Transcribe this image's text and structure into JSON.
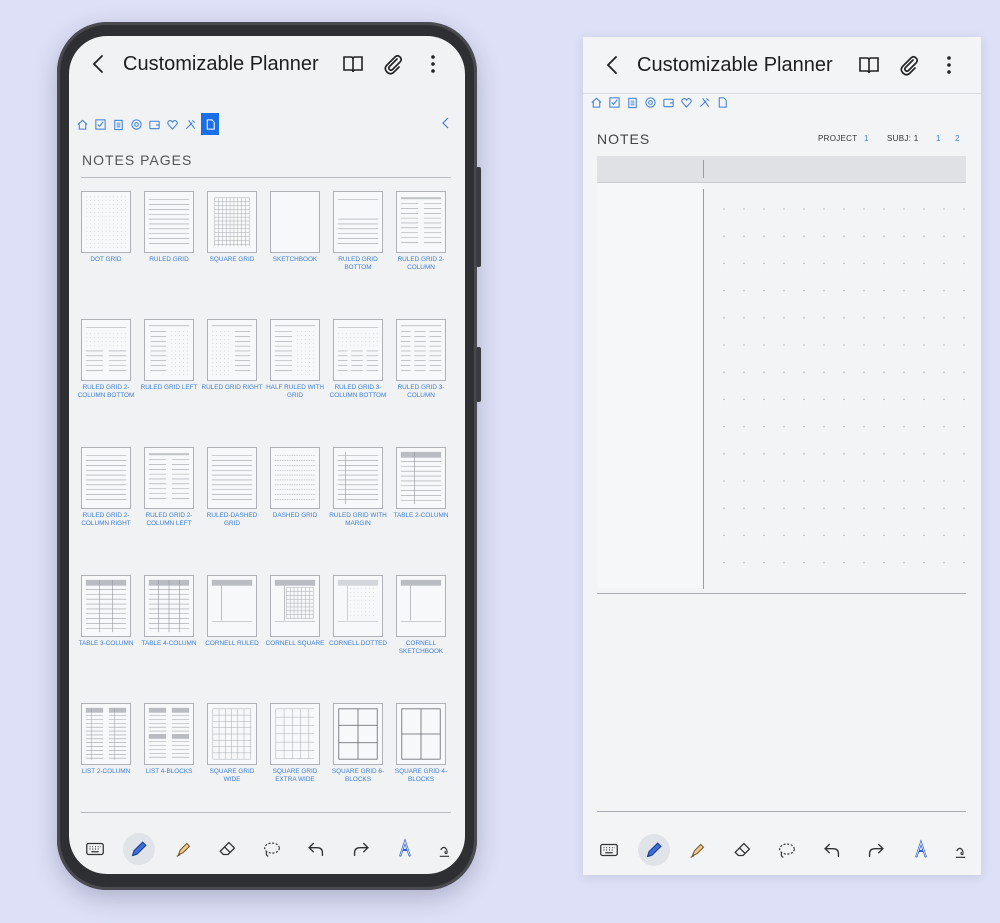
{
  "app": {
    "title": "Customizable Planner"
  },
  "tabs": [
    {
      "name": "home-tab-icon"
    },
    {
      "name": "checkbox-tab-icon"
    },
    {
      "name": "clipboard-tab-icon"
    },
    {
      "name": "target-tab-icon"
    },
    {
      "name": "wallet-tab-icon"
    },
    {
      "name": "heart-tab-icon"
    },
    {
      "name": "tools-tab-icon"
    },
    {
      "name": "notes-tab-icon"
    }
  ],
  "accent_color": "#3d7fd6",
  "active_tab_color": "#1a6fe8",
  "notes_index": {
    "heading": "NOTES PAGES",
    "templates": [
      {
        "label": "DOT GRID",
        "kind": "dot"
      },
      {
        "label": "RULED GRID",
        "kind": "ruled"
      },
      {
        "label": "SQUARE GRID",
        "kind": "square"
      },
      {
        "label": "SKETCHBOOK",
        "kind": "blank"
      },
      {
        "label": "RULED GRID BOTTOM",
        "kind": "ruled-bottom"
      },
      {
        "label": "RULED GRID 2-COLUMN",
        "kind": "ruled-2col"
      },
      {
        "label": "RULED GRID 2-COLUMN BOTTOM",
        "kind": "ruled-2col-bottom"
      },
      {
        "label": "RULED GRID LEFT",
        "kind": "ruled-left"
      },
      {
        "label": "RULED GRID RIGHT",
        "kind": "ruled-right"
      },
      {
        "label": "HALF RULED WITH GRID",
        "kind": "half-ruled"
      },
      {
        "label": "RULED GRID 3-COLUMN BOTTOM",
        "kind": "ruled-3col-bottom"
      },
      {
        "label": "RULED GRID 3-COLUMN",
        "kind": "ruled-3col"
      },
      {
        "label": "RULED GRID 2-COLUMN RIGHT",
        "kind": "ruled"
      },
      {
        "label": "RULED GRID 2-COLUMN LEFT",
        "kind": "ruled-2col"
      },
      {
        "label": "RULED-DASHED GRID",
        "kind": "ruled"
      },
      {
        "label": "DASHED GRID",
        "kind": "dashed"
      },
      {
        "label": "RULED GRID WITH MARGIN",
        "kind": "ruled-margin"
      },
      {
        "label": "TABLE 2-COLUMN",
        "kind": "table2"
      },
      {
        "label": "TABLE 3-COLUMN",
        "kind": "table3"
      },
      {
        "label": "TABLE 4-COLUMN",
        "kind": "table4"
      },
      {
        "label": "CORNELL RULED",
        "kind": "cornell-ruled"
      },
      {
        "label": "CORNELL SQUARE",
        "kind": "cornell-square"
      },
      {
        "label": "CORNELL DOTTED",
        "kind": "cornell-dotted"
      },
      {
        "label": "CORNELL SKETCHBOOK",
        "kind": "cornell-blank"
      },
      {
        "label": "LIST 2-COLUMN",
        "kind": "list2"
      },
      {
        "label": "LIST 4-BLOCKS",
        "kind": "list4"
      },
      {
        "label": "SQUARE GRID WIDE",
        "kind": "square-wide"
      },
      {
        "label": "SQUARE GRID EXTRA WIDE",
        "kind": "square-xwide"
      },
      {
        "label": "SQUARE GRID 6-BLOCKS",
        "kind": "blocks6"
      },
      {
        "label": "SQUARE GRID 4-BLOCKS",
        "kind": "blocks4"
      }
    ]
  },
  "notes_page": {
    "heading": "NOTES",
    "project_label": "PROJECT",
    "project_value": "1",
    "subj_label": "SUBJ: 1",
    "page_1": "1",
    "page_2": "2"
  },
  "toolbar": [
    {
      "name": "keyboard-icon",
      "selected": false
    },
    {
      "name": "pen-icon",
      "selected": true
    },
    {
      "name": "highlighter-icon",
      "selected": false
    },
    {
      "name": "eraser-icon",
      "selected": false
    },
    {
      "name": "lasso-icon",
      "selected": false
    },
    {
      "name": "undo-icon",
      "selected": false
    },
    {
      "name": "redo-icon",
      "selected": false
    },
    {
      "name": "text-recognition-icon",
      "selected": false
    },
    {
      "name": "handwriting-icon",
      "selected": false
    }
  ]
}
